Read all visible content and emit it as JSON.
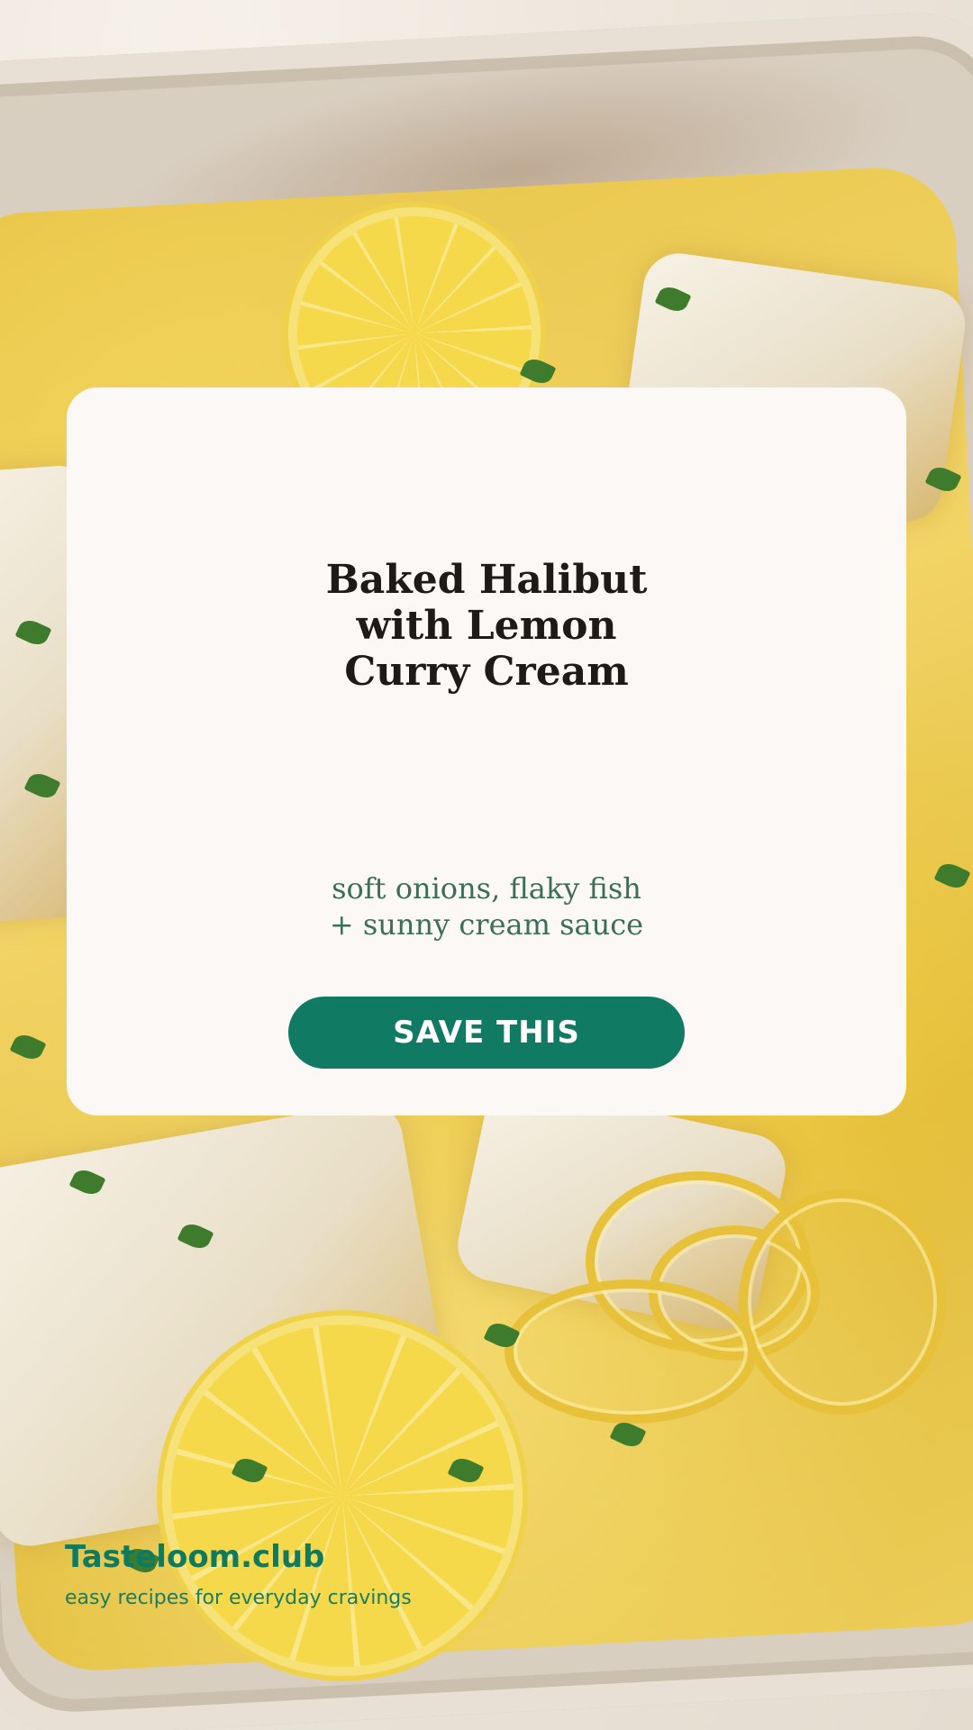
{
  "card": {
    "title": "Baked Halibut\nwith Lemon\nCurry Cream",
    "subtitle": "soft onions, flaky fish\n+ sunny cream sauce",
    "save_label": "SAVE THIS"
  },
  "brand": {
    "name": "Tasteloom.club",
    "tagline": "easy recipes for everyday cravings"
  },
  "colors": {
    "accent": "#107a62",
    "card_background": "#fcf8f5",
    "title_text": "#1d1a17",
    "subtitle_text": "#3b6f58"
  }
}
